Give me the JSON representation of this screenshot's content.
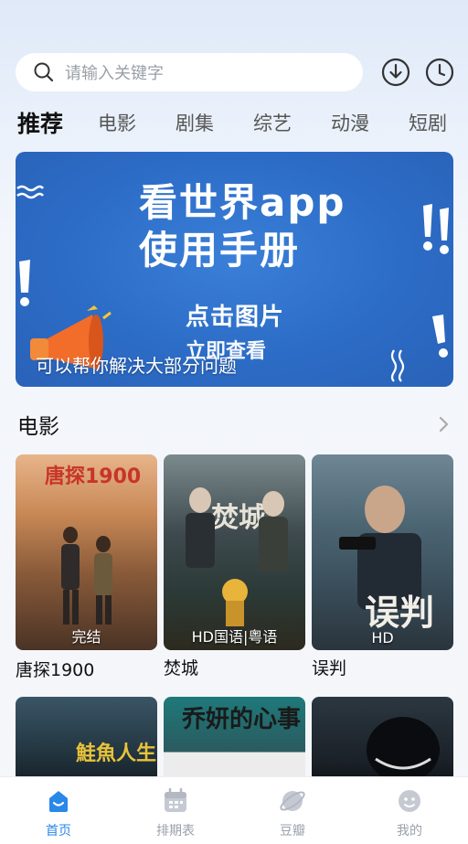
{
  "search": {
    "placeholder": "请输入关键字"
  },
  "tabs": [
    {
      "label": "推荐",
      "active": true
    },
    {
      "label": "电影"
    },
    {
      "label": "剧集"
    },
    {
      "label": "综艺"
    },
    {
      "label": "动漫"
    },
    {
      "label": "短剧"
    }
  ],
  "banner": {
    "title_line1": "看世界app",
    "title_line2": "使用手册",
    "sub_line1": "点击图片",
    "sub_line2": "立即查看",
    "caption": "可以帮你解决大部分问题"
  },
  "section": {
    "title": "电影"
  },
  "movies": [
    {
      "name": "唐探1900",
      "badge": "完结",
      "poster_title": "唐探1900"
    },
    {
      "name": "焚城",
      "badge": "HD国语|粤语",
      "poster_title": "焚城"
    },
    {
      "name": "误判",
      "badge": "HD",
      "poster_title": "误判"
    }
  ],
  "movies_row2": [
    {
      "poster_title": "鮭魚人生"
    },
    {
      "poster_title": "乔妍的心事"
    },
    {
      "poster_title": ""
    }
  ],
  "nav": [
    {
      "label": "首页",
      "icon": "home-icon",
      "active": true
    },
    {
      "label": "排期表",
      "icon": "calendar-icon"
    },
    {
      "label": "豆瓣",
      "icon": "planet-icon"
    },
    {
      "label": "我的",
      "icon": "profile-icon"
    }
  ],
  "colors": {
    "accent": "#2a88e8",
    "banner_blue": "#2c6cc6"
  }
}
